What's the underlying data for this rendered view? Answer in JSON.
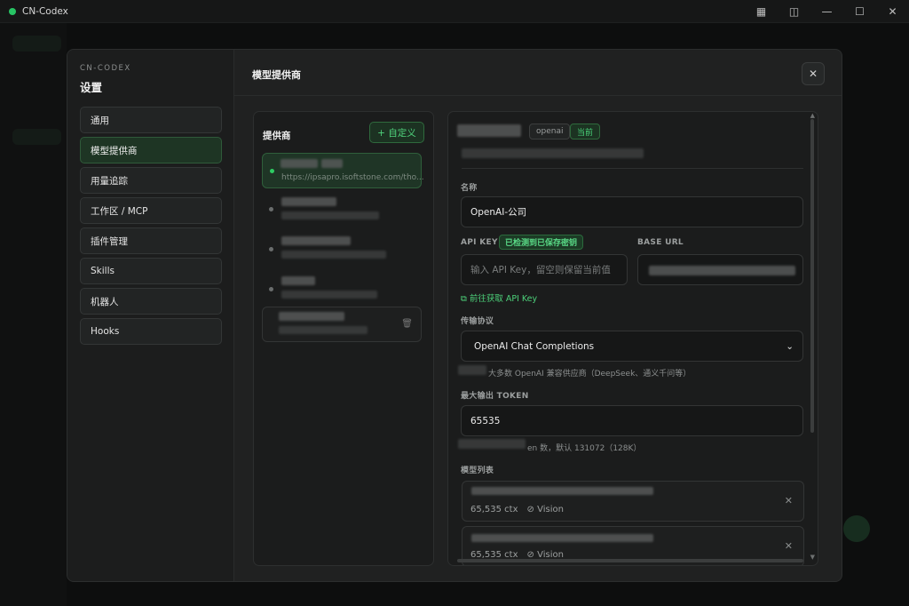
{
  "app": {
    "title": "CN-Codex",
    "accent": "#27c464"
  },
  "window_controls": [
    {
      "name": "grid-icon",
      "glyph": "▦"
    },
    {
      "name": "panel-icon",
      "glyph": "◫"
    },
    {
      "name": "minimize-icon",
      "glyph": "—"
    },
    {
      "name": "maximize-icon",
      "glyph": "☐"
    },
    {
      "name": "close-icon",
      "glyph": "✕"
    }
  ],
  "settings": {
    "brand": "CN-CODEX",
    "title": "设置",
    "nav": [
      "通用",
      "模型提供商",
      "用量追踪",
      "工作区 / MCP",
      "插件管理",
      "Skills",
      "机器人",
      "Hooks"
    ],
    "active_index": 1,
    "close_glyph": "✕"
  },
  "header": {
    "title": "模型提供商"
  },
  "providers": {
    "heading": "提供商",
    "custom_button": "+ 自定义",
    "active_url": "https://ipsapro.isoftstone.com/tho..."
  },
  "detail": {
    "type_tag": "openai",
    "current_tag": "当前",
    "name_label": "名称",
    "name_value": "OpenAI-公司",
    "api_key_label": "API KEY",
    "api_key_badge": "已检测到已保存密钥",
    "api_key_placeholder": "输入 API Key，留空则保留当前值",
    "base_url_label": "BASE URL",
    "get_key_link": "前往获取 API Key",
    "protocol_label": "传输协议",
    "protocol_value": "OpenAI Chat Completions",
    "protocol_hint": "大多数 OpenAI 兼容供应商（DeepSeek、通义千问等）",
    "max_output_label": "最大输出 TOKEN",
    "max_output_value": "65535",
    "max_output_hint": "en 数，默认 131072（128K）",
    "models_label": "模型列表",
    "models": [
      {
        "ctx": "65,535 ctx",
        "vision": "Vision"
      },
      {
        "ctx": "65,535 ctx",
        "vision": "Vision"
      }
    ]
  }
}
